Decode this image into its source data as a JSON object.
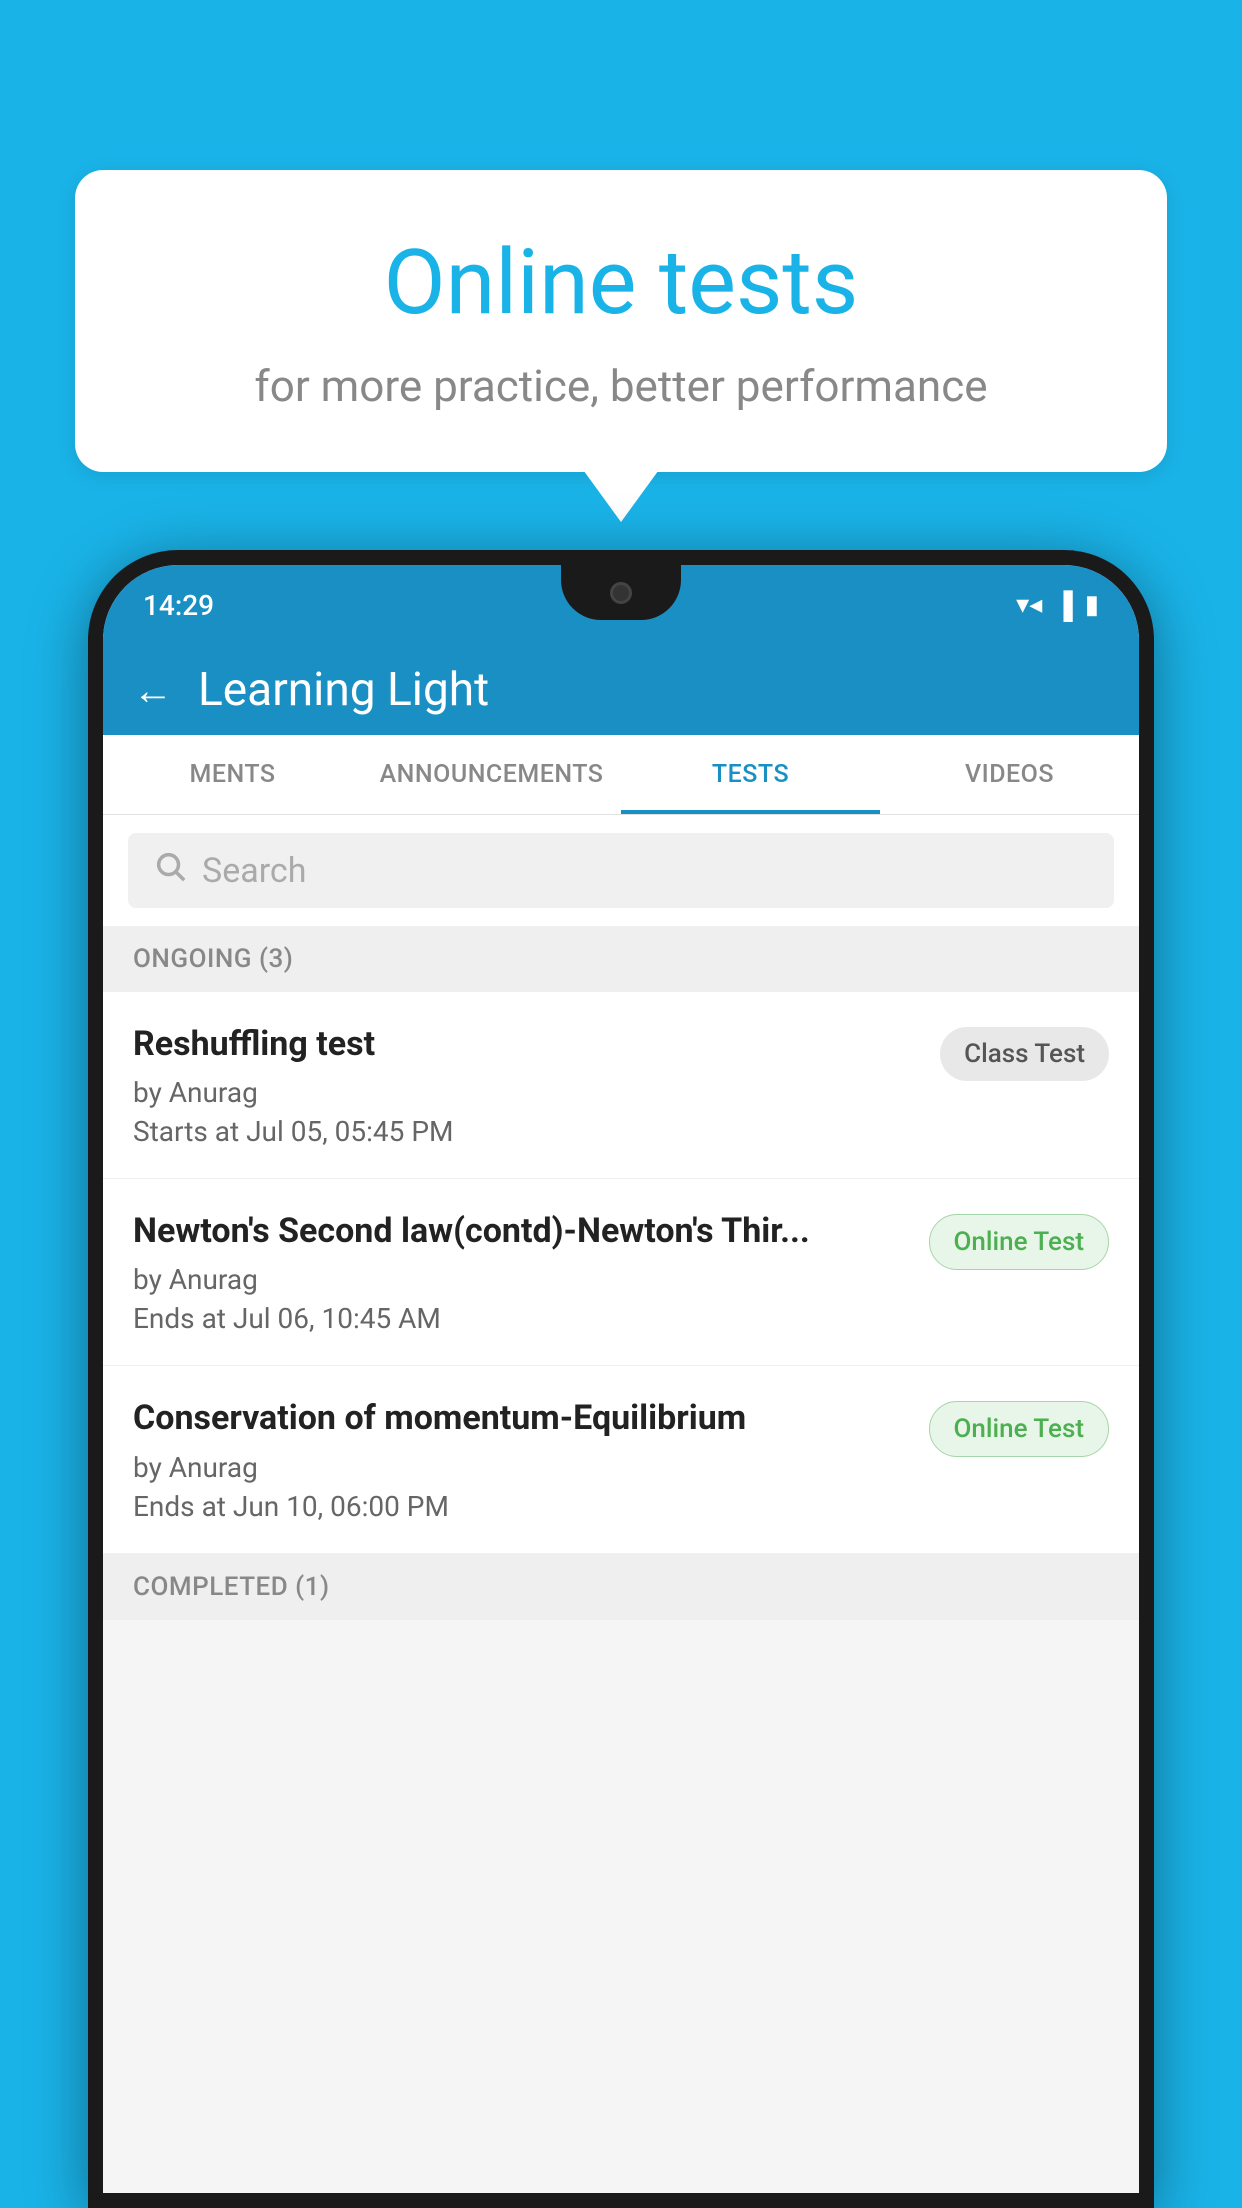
{
  "background_color": "#1ab3e8",
  "speech_bubble": {
    "title": "Online tests",
    "subtitle": "for more practice, better performance"
  },
  "phone": {
    "status_bar": {
      "time": "14:29",
      "wifi": "▼▲",
      "signal": "◀",
      "battery": "▮"
    },
    "app_header": {
      "back_label": "←",
      "title": "Learning Light"
    },
    "tabs": [
      {
        "label": "MENTS",
        "active": false
      },
      {
        "label": "ANNOUNCEMENTS",
        "active": false
      },
      {
        "label": "TESTS",
        "active": true
      },
      {
        "label": "VIDEOS",
        "active": false
      }
    ],
    "search": {
      "placeholder": "Search"
    },
    "ongoing_section": {
      "title": "ONGOING (3)",
      "items": [
        {
          "name": "Reshuffling test",
          "author": "by Anurag",
          "date": "Starts at  Jul 05, 05:45 PM",
          "badge": "Class Test",
          "badge_type": "class"
        },
        {
          "name": "Newton's Second law(contd)-Newton's Thir...",
          "author": "by Anurag",
          "date": "Ends at  Jul 06, 10:45 AM",
          "badge": "Online Test",
          "badge_type": "online"
        },
        {
          "name": "Conservation of momentum-Equilibrium",
          "author": "by Anurag",
          "date": "Ends at  Jun 10, 06:00 PM",
          "badge": "Online Test",
          "badge_type": "online"
        }
      ]
    },
    "completed_section": {
      "title": "COMPLETED (1)"
    }
  }
}
